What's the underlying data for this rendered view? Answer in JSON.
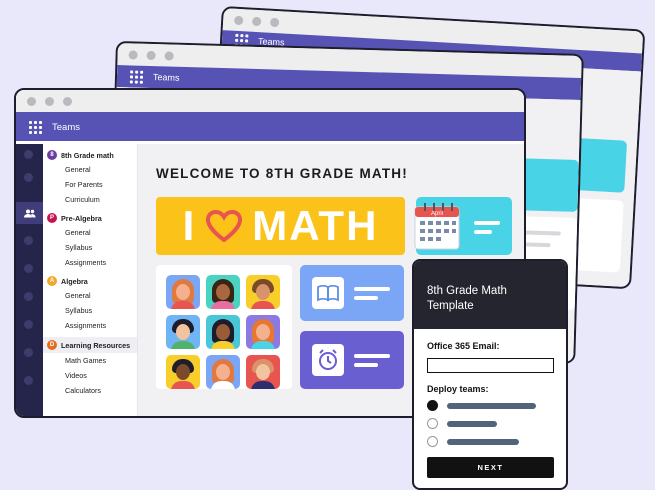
{
  "windows": {
    "back": {
      "title": "Teams"
    },
    "middle": {
      "title": "Teams"
    },
    "front": {
      "title": "Teams"
    }
  },
  "sidebar": {
    "teams": [
      {
        "name": "8th Grade math",
        "initial": "8",
        "color": "#6b3fa0",
        "channels": [
          "General",
          "For Parents",
          "Curriculum"
        ]
      },
      {
        "name": "Pre-Algebra",
        "initial": "P",
        "color": "#c4154f",
        "channels": [
          "General",
          "Syllabus",
          "Assignments"
        ]
      },
      {
        "name": "Algebra",
        "initial": "A",
        "color": "#f3a72a",
        "channels": [
          "General",
          "Syllabus",
          "Assignments"
        ]
      },
      {
        "name": "Learning Resources",
        "initial": "D",
        "color": "#e56b1f",
        "channels": [
          "Math Games",
          "Videos",
          "Calculators"
        ]
      }
    ]
  },
  "main": {
    "welcome": "WELCOME TO 8TH GRADE MATH!",
    "banner": {
      "left": "I",
      "right": "MATH",
      "heart_color": "#e8544f"
    },
    "calendar_month": "April"
  },
  "form": {
    "title_line1": "8th Grade Math",
    "title_line2": "Template",
    "email_label": "Office 365 Email:",
    "email_value": "",
    "deploy_label": "Deploy teams:",
    "next_label": "NEXT"
  },
  "colors": {
    "accent": "#5653b4",
    "banner": "#fbc21a",
    "cyan": "#49d3e6",
    "blue": "#7aa6f5",
    "purple": "#6a5fd0"
  },
  "icons": [
    "app-grid-icon",
    "people-icon",
    "heart-icon",
    "calendar-icon",
    "book-icon",
    "alarm-clock-icon"
  ]
}
